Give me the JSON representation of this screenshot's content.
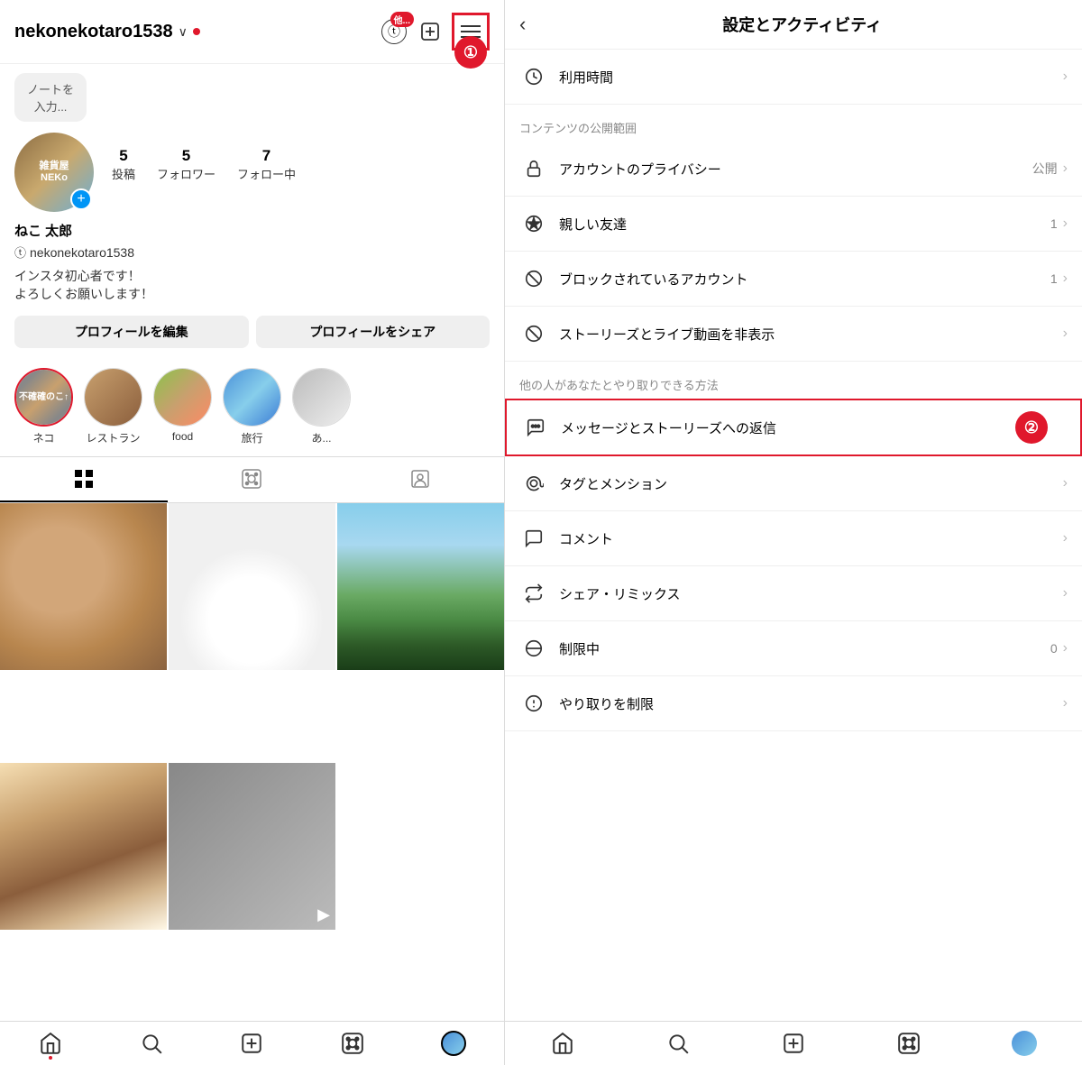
{
  "left": {
    "username": "nekonekotaro1538",
    "chevron": "∨",
    "note_placeholder": "ノートを入力...",
    "avatar_text": "雑貨屋\nNEKo",
    "stats": [
      {
        "num": "5",
        "label": "投稿"
      },
      {
        "num": "5",
        "label": "フォロワー"
      },
      {
        "num": "7",
        "label": "フォロー中"
      }
    ],
    "display_name": "ねこ 太郎",
    "threads_handle": "nekonekotaro1538",
    "bio_line1": "インスタ初心者です！",
    "bio_line2": "よろしくお願いします！",
    "edit_profile_btn": "プロフィールを編集",
    "share_profile_btn": "プロフィールをシェア",
    "highlights": [
      {
        "label": "ネコ"
      },
      {
        "label": "レストラン"
      },
      {
        "label": "food"
      },
      {
        "label": "旅行"
      },
      {
        "label": "あ..."
      }
    ],
    "tabs": [
      "⊞",
      "▶",
      "👤"
    ],
    "bottom_nav": [
      "🏠",
      "🔍",
      "➕",
      "▶",
      "avatar"
    ]
  },
  "right": {
    "back_label": "‹",
    "title": "設定とアクティビティ",
    "sections": [
      {
        "items": [
          {
            "icon": "clock",
            "label": "利用時間",
            "value": "",
            "chevron": true
          }
        ]
      },
      {
        "header": "コンテンツの公開範囲",
        "items": [
          {
            "icon": "lock",
            "label": "アカウントのプライバシー",
            "value": "公開",
            "chevron": true
          },
          {
            "icon": "star",
            "label": "親しい友達",
            "value": "1",
            "chevron": true
          },
          {
            "icon": "block",
            "label": "ブロックされているアカウント",
            "value": "1",
            "chevron": true
          },
          {
            "icon": "mute",
            "label": "ストーリーズとライブ動画を非表示",
            "value": "",
            "chevron": true
          }
        ]
      },
      {
        "header": "他の人があなたとやり取りできる方法",
        "items": [
          {
            "icon": "messenger",
            "label": "メッセージとストーリーズへの返信",
            "value": "",
            "chevron": true,
            "highlighted": true
          },
          {
            "icon": "mention",
            "label": "タグとメンション",
            "value": "",
            "chevron": true
          },
          {
            "icon": "comment",
            "label": "コメント",
            "value": "",
            "chevron": true
          },
          {
            "icon": "share",
            "label": "シェア・リミックス",
            "value": "",
            "chevron": true
          },
          {
            "icon": "restrict",
            "label": "制限中",
            "value": "0",
            "chevron": true
          },
          {
            "icon": "limit",
            "label": "やり取りを制限",
            "value": "",
            "chevron": true
          }
        ]
      }
    ],
    "bottom_nav": [
      "🏠",
      "🔍",
      "➕",
      "▶",
      "avatar"
    ]
  },
  "annotations": {
    "circle1_label": "①",
    "circle2_label": "②"
  }
}
